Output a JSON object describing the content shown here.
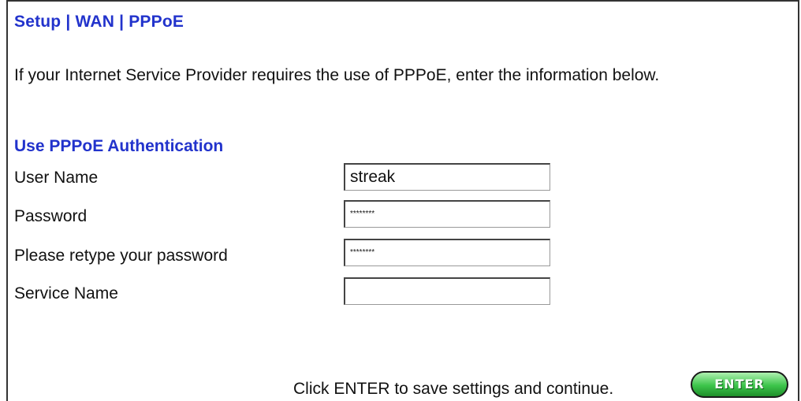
{
  "header": {
    "breadcrumb": "Setup | WAN | PPPoE"
  },
  "intro_text": "If your Internet Service Provider requires the use of PPPoE, enter the information below.",
  "section": {
    "title": "Use PPPoE Authentication"
  },
  "form": {
    "user_name_label": "User Name",
    "user_name_value": "streak",
    "password_label": "Password",
    "password_value": "********",
    "retype_label": "Please retype your password",
    "retype_value": "********",
    "service_name_label": "Service Name",
    "service_name_value": ""
  },
  "footer": {
    "instruction": "Click ENTER to save settings and continue.",
    "enter_label": "ENTER"
  },
  "colors": {
    "heading": "#2233cc",
    "enter_button": "#3cc44a"
  }
}
